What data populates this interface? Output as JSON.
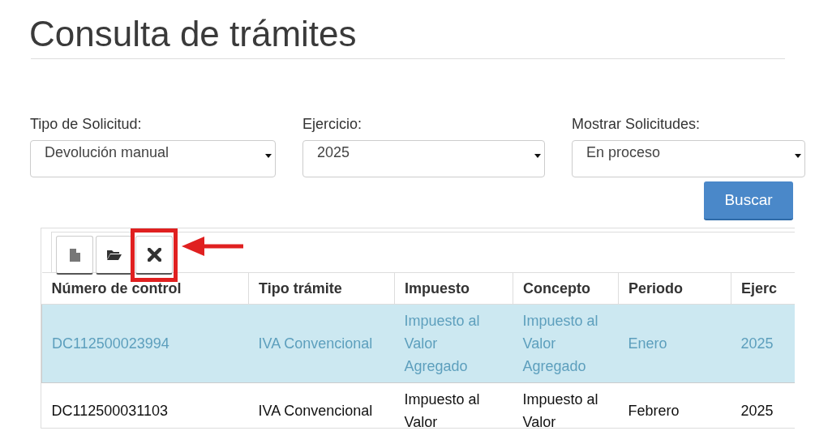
{
  "page": {
    "title": "Consulta de trámites"
  },
  "filters": [
    {
      "label": "Tipo de Solicitud:",
      "value": "Devolución manual"
    },
    {
      "label": "Ejercicio:",
      "value": "2025"
    },
    {
      "label": "Mostrar Solicitudes:",
      "value": "En proceso"
    }
  ],
  "search_button": "Buscar",
  "toolbar": [
    {
      "kind": "new",
      "highlighted": false
    },
    {
      "kind": "open",
      "highlighted": false
    },
    {
      "kind": "delete",
      "highlighted": true
    }
  ],
  "table": {
    "columns": [
      "Número de control",
      "Tipo trámite",
      "Impuesto",
      "Concepto",
      "Periodo",
      "Ejerc"
    ],
    "rows": [
      {
        "selected": true,
        "cells": [
          "DC112500023994",
          "IVA Convencional",
          "Impuesto al Valor Agregado",
          "Impuesto al Valor Agregado",
          "Enero",
          "2025"
        ]
      },
      {
        "selected": false,
        "cells": [
          "DC112500031103",
          "IVA Convencional",
          "Impuesto al Valor",
          "Impuesto al Valor",
          "Febrero",
          "2025"
        ]
      }
    ]
  }
}
